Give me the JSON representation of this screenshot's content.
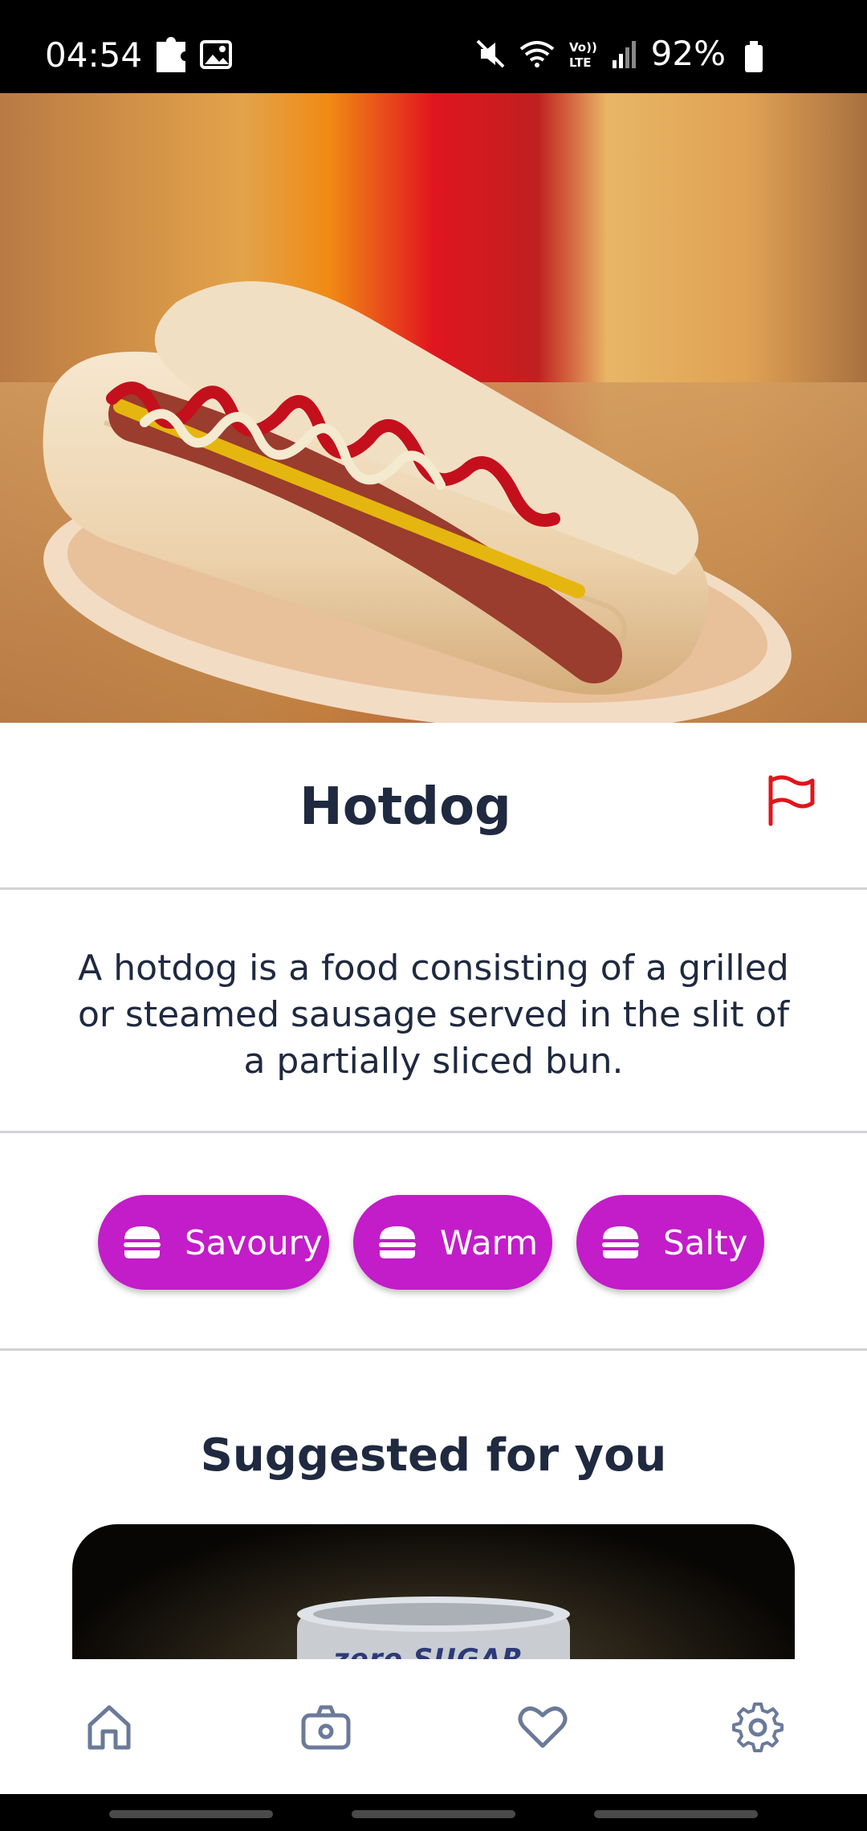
{
  "status_bar": {
    "time": "04:54",
    "battery": "92%"
  },
  "hero": {
    "alt": "hotdog-photo"
  },
  "item": {
    "title": "Hotdog",
    "description": "A hotdog is a food consisting of a grilled or steamed sausage served in the slit of a partially sliced bun.",
    "report_icon": "flag-icon"
  },
  "tags": [
    {
      "label": "Savoury",
      "icon": "burger-icon"
    },
    {
      "label": "Warm",
      "icon": "burger-icon"
    },
    {
      "label": "Salty",
      "icon": "burger-icon"
    }
  ],
  "suggested": {
    "title": "Suggested for you",
    "card_text": "zero SUGAR"
  },
  "bottom_nav": [
    {
      "icon": "home-icon"
    },
    {
      "icon": "camera-icon"
    },
    {
      "icon": "heart-icon"
    },
    {
      "icon": "gear-icon"
    }
  ],
  "colors": {
    "accent": "#c31cc9",
    "flag": "#e0151b",
    "text": "#1f2940",
    "nav_icon": "#6b7a99"
  }
}
